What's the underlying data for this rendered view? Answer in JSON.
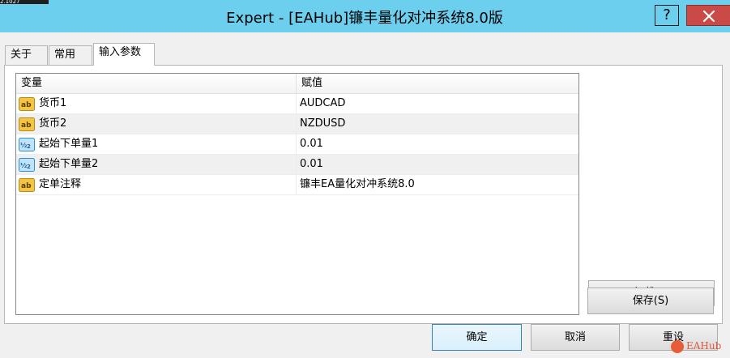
{
  "window": {
    "title": "Expert - [EAHub]镰丰量化对冲系统8.0版",
    "help_label": "?",
    "corner_text": "2.1027"
  },
  "tabs": [
    {
      "label": "关于",
      "active": false
    },
    {
      "label": "常用",
      "active": false
    },
    {
      "label": "输入参数",
      "active": true
    }
  ],
  "grid": {
    "headers": {
      "variable": "变量",
      "value": "赋值"
    },
    "rows": [
      {
        "icon": "string-icon",
        "name": "货币1",
        "value": "AUDCAD"
      },
      {
        "icon": "string-icon",
        "name": "货币2",
        "value": "NZDUSD"
      },
      {
        "icon": "double-icon",
        "name": "起始下单量1",
        "value": "0.01"
      },
      {
        "icon": "double-icon",
        "name": "起始下单量2",
        "value": "0.01"
      },
      {
        "icon": "string-icon",
        "name": "定单注释",
        "value": "镰丰EA量化对冲系统8.0"
      }
    ]
  },
  "buttons": {
    "load": "加载(L)",
    "save": "保存(S)",
    "ok": "确定",
    "cancel": "取消",
    "reset": "重设"
  },
  "watermark": {
    "text": "EAHub"
  },
  "colors": {
    "titlebar": "#6ccfee",
    "close": "#c94a47",
    "string_icon": "#d9a62e",
    "double_icon": "#2b8fd6"
  }
}
